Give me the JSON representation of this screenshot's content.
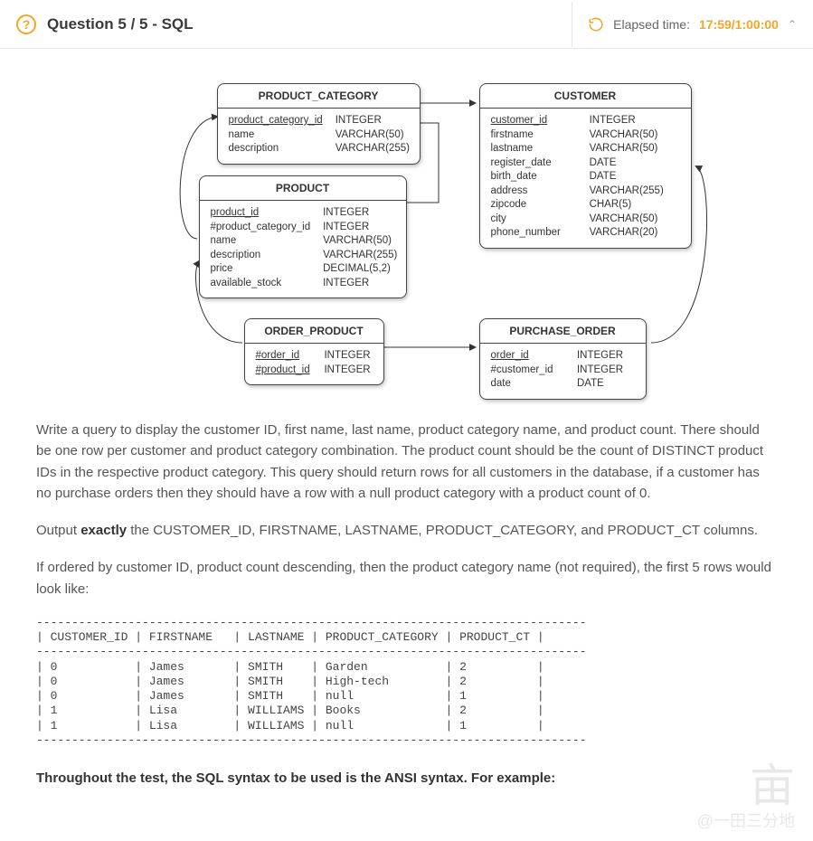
{
  "header": {
    "question_label": "Question 5 / 5 - SQL",
    "elapsed_label": "Elapsed time:",
    "elapsed_value": "17:59/1:00:00"
  },
  "entities": {
    "product_category": {
      "title": "PRODUCT_CATEGORY",
      "cols": [
        {
          "n": "product_category_id",
          "t": "INTEGER",
          "pk": true
        },
        {
          "n": "name",
          "t": "VARCHAR(50)"
        },
        {
          "n": "description",
          "t": "VARCHAR(255)"
        }
      ]
    },
    "product": {
      "title": "PRODUCT",
      "cols": [
        {
          "n": "product_id",
          "t": "INTEGER",
          "pk": true
        },
        {
          "n": "#product_category_id",
          "t": "INTEGER"
        },
        {
          "n": "name",
          "t": "VARCHAR(50)"
        },
        {
          "n": "description",
          "t": "VARCHAR(255)"
        },
        {
          "n": "price",
          "t": "DECIMAL(5,2)"
        },
        {
          "n": "available_stock",
          "t": "INTEGER"
        }
      ]
    },
    "order_product": {
      "title": "ORDER_PRODUCT",
      "cols": [
        {
          "n": "#order_id",
          "t": "INTEGER",
          "pk": true
        },
        {
          "n": "#product_id",
          "t": "INTEGER",
          "pk": true
        }
      ]
    },
    "customer": {
      "title": "CUSTOMER",
      "cols": [
        {
          "n": "customer_id",
          "t": "INTEGER",
          "pk": true
        },
        {
          "n": "firstname",
          "t": "VARCHAR(50)"
        },
        {
          "n": "lastname",
          "t": "VARCHAR(50)"
        },
        {
          "n": "register_date",
          "t": "DATE"
        },
        {
          "n": "birth_date",
          "t": "DATE"
        },
        {
          "n": "address",
          "t": "VARCHAR(255)"
        },
        {
          "n": "zipcode",
          "t": "CHAR(5)"
        },
        {
          "n": "city",
          "t": "VARCHAR(50)"
        },
        {
          "n": "phone_number",
          "t": "VARCHAR(20)"
        }
      ]
    },
    "purchase_order": {
      "title": "PURCHASE_ORDER",
      "cols": [
        {
          "n": "order_id",
          "t": "INTEGER",
          "pk": true
        },
        {
          "n": "#customer_id",
          "t": "INTEGER"
        },
        {
          "n": "date",
          "t": "DATE"
        }
      ]
    }
  },
  "prose": {
    "p1": "Write a query to display the customer ID, first name, last name, product category name, and product count. There should be one row per customer and product category combination. The product count should be the count of DISTINCT product IDs in the respective product category. This query should return rows for all customers in the database, if a customer has no purchase orders then they should have a row with a null product category with a product count of 0.",
    "p2a": "Output ",
    "p2b": "exactly",
    "p2c": " the CUSTOMER_ID, FIRSTNAME, LASTNAME, PRODUCT_CATEGORY, and PRODUCT_CT columns.",
    "p3": "If ordered by customer ID, product count descending, then the product category name (not required), the first 5 rows would look like:",
    "footer_bold": "Throughout the test, the SQL syntax to be used is the ANSI syntax. For example:"
  },
  "sample_table": "------------------------------------------------------------------------------\n| CUSTOMER_ID | FIRSTNAME   | LASTNAME | PRODUCT_CATEGORY | PRODUCT_CT |\n------------------------------------------------------------------------------\n| 0           | James       | SMITH    | Garden           | 2          |\n| 0           | James       | SMITH    | High-tech        | 2          |\n| 0           | James       | SMITH    | null             | 1          |\n| 1           | Lisa        | WILLIAMS | Books            | 2          |\n| 1           | Lisa        | WILLIAMS | null             | 1          |\n------------------------------------------------------------------------------",
  "watermark": {
    "big": "亩",
    "small": "@一田三分地"
  }
}
